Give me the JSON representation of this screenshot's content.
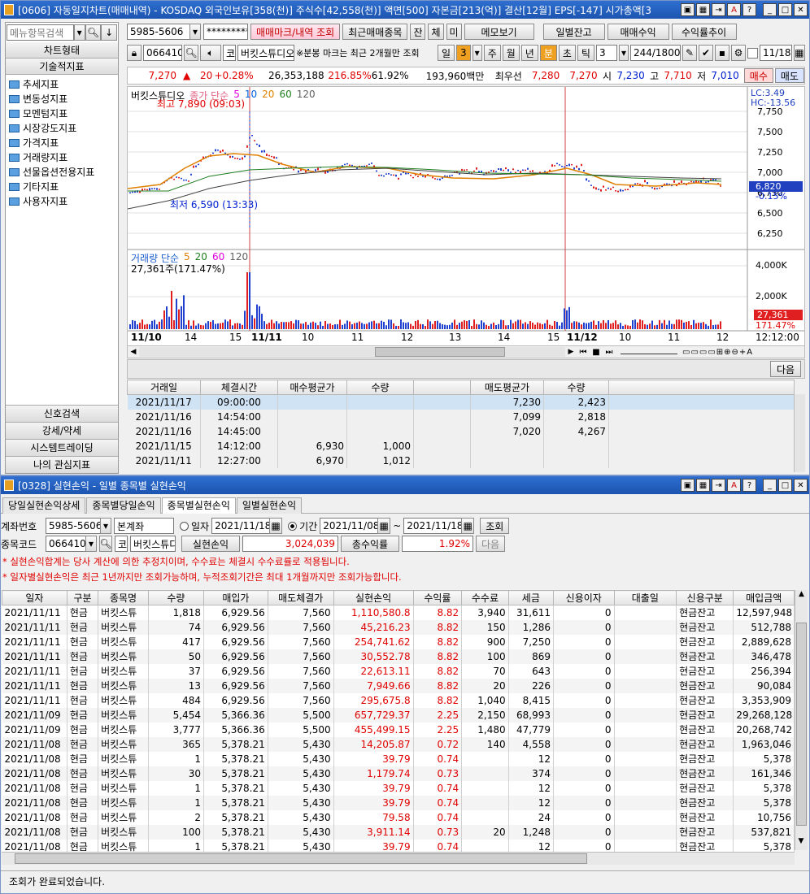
{
  "top_window": {
    "title": "[0606] 자동일지차트(매매내역) - KOSDAQ 외국인보유[358(천)] 주식수[42,558(천)] 액면[500] 자본금[213(억)] 결산[12월] EPS[-147] 시가총액[3"
  },
  "left_panel": {
    "search_placeholder": "메뉴항목검색",
    "tab_chart_type": "차트형태",
    "tab_technical": "기술적지표",
    "tree": [
      "추세지표",
      "변동성지표",
      "모멘텀지표",
      "시장강도지표",
      "가격지표",
      "거래량지표",
      "선물옵션전용지표",
      "기타지표",
      "사용자지표"
    ],
    "bottom": [
      "신호검색",
      "강세/약세",
      "시스템트레이딩",
      "나의 관심지표"
    ]
  },
  "toolbar1": {
    "account": "5985-5606",
    "password": "*********",
    "btn_trade_mark": "매매마크/내역 조회",
    "btn_recent": "최근매매종목",
    "btn_jan": "잔",
    "btn_che": "체",
    "btn_mi": "미",
    "btn_memo": "메모보기",
    "btn_daily_bal": "일별잔고",
    "btn_profit": "매매수익",
    "btn_rate_trend": "수익률추이"
  },
  "toolbar2": {
    "code": "066410",
    "market": "코",
    "stock_name": "버킷스튜디오",
    "note": "※분봉 마크는 최근 2개월만 조회",
    "periods": [
      "일",
      "3",
      "주",
      "월",
      "년",
      "분",
      "초",
      "틱"
    ],
    "interval": "3",
    "count": "244",
    "count_max": "/1800",
    "date": "11/18"
  },
  "quote": {
    "price": "7,270",
    "arrow": "▲",
    "change": "20",
    "change_pct": "+0.28%",
    "volume": "26,353,188",
    "turnover_pct": "216.85%",
    "foreign_pct": "61.92%",
    "amount": "193,960백만",
    "best_ask_label": "최우선",
    "bid": "7,280",
    "ask": "7,270",
    "open_label": "시",
    "open": "7,230",
    "high_label": "고",
    "high": "7,710",
    "low_label": "저",
    "low": "7,010",
    "sell_btn": "매수",
    "buy_btn": "매도"
  },
  "price_chart": {
    "legend_name": "버킷스튜디오",
    "legend_ma": "종가 단순",
    "mas": [
      "5",
      "10",
      "20",
      "60",
      "120"
    ],
    "max_label": "최고 7,890 (09:03)",
    "min_label": "최저 6,590 (13:33)",
    "lc": "LC:3.49",
    "hc": "HC:-13.56",
    "y_ticks": [
      "7,750",
      "7,500",
      "7,250",
      "7,000",
      "6,750",
      "6,500",
      "6,250"
    ],
    "cur_price": "6,820",
    "cur_pct": "-0.15%"
  },
  "volume_chart": {
    "legend": "거래량 단순",
    "mas": [
      "5",
      "20",
      "60",
      "120"
    ],
    "value_label": "27,361주(171.47%)",
    "y_ticks": [
      "4,000K",
      "2,000K"
    ],
    "cur_val": "27,361",
    "cur_pct": "171.47%"
  },
  "x_axis": {
    "labels": [
      "11/10",
      "14",
      "15",
      "11/11",
      "10",
      "11",
      "12",
      "13",
      "14",
      "15",
      "11/12",
      "10",
      "11",
      "12"
    ],
    "time": "12:12:00"
  },
  "next_btn": "다음",
  "trade_table": {
    "headers": [
      "거래일",
      "체결시간",
      "매수평균가",
      "수량",
      "",
      "매도평균가",
      "수량"
    ],
    "rows": [
      [
        "2021/11/17",
        "09:00:00",
        "",
        "",
        "",
        "7,230",
        "2,423"
      ],
      [
        "2021/11/16",
        "14:54:00",
        "",
        "",
        "",
        "7,099",
        "2,818"
      ],
      [
        "2021/11/16",
        "14:45:00",
        "",
        "",
        "",
        "7,020",
        "4,267"
      ],
      [
        "2021/11/15",
        "14:12:00",
        "6,930",
        "1,000",
        "",
        "",
        ""
      ],
      [
        "2021/11/11",
        "12:27:00",
        "6,970",
        "1,012",
        "",
        "",
        ""
      ]
    ]
  },
  "bottom_window": {
    "title": "[0328] 실현손익 - 일별 종목별 실현손익",
    "tabs": [
      "당일실현손익상세",
      "종목별당일손익",
      "종목별실현손익",
      "일별실현손익"
    ],
    "acct_label": "계좌번호",
    "account": "5985-5606",
    "acct_type": "본계좌",
    "radio_date": "일자",
    "date": "2021/11/18",
    "radio_period": "기간",
    "from": "2021/11/08",
    "tilde": "~",
    "to": "2021/11/18",
    "btn_query": "조회",
    "code_label": "종목코드",
    "code": "066410",
    "market": "코",
    "stock_name": "버킷스튜디오",
    "realized_label": "실현손익",
    "realized": "3,024,039",
    "rate_label": "총수익률",
    "rate": "1.92%",
    "btn_next": "다음",
    "notice1": "* 실현손익합계는 당사 계산에 의한 추정치이며, 수수료는 체결시 수수료률로 적용됩니다.",
    "notice2": "* 일자별실현손익은 최근 1년까지만 조회가능하며, 누적조회기간은 최대 1개월까지만 조회가능합니다.",
    "status": "조회가 완료되었습니다."
  },
  "pl_table": {
    "headers": [
      "일자",
      "구분",
      "종목명",
      "수량",
      "매입가",
      "매도체결가",
      "실현손익",
      "수익률",
      "수수료",
      "세금",
      "신용이자",
      "대출일",
      "신용구분",
      "매입금액"
    ],
    "rows": [
      [
        "2021/11/11",
        "현금",
        "버킷스튜",
        "1,818",
        "6,929.56",
        "7,560",
        "1,110,580.8",
        "8.82",
        "3,940",
        "31,611",
        "0",
        "",
        "현금잔고",
        "12,597,948"
      ],
      [
        "2021/11/11",
        "현금",
        "버킷스튜",
        "74",
        "6,929.56",
        "7,560",
        "45,216.23",
        "8.82",
        "150",
        "1,286",
        "0",
        "",
        "현금잔고",
        "512,788"
      ],
      [
        "2021/11/11",
        "현금",
        "버킷스튜",
        "417",
        "6,929.56",
        "7,560",
        "254,741.62",
        "8.82",
        "900",
        "7,250",
        "0",
        "",
        "현금잔고",
        "2,889,628"
      ],
      [
        "2021/11/11",
        "현금",
        "버킷스튜",
        "50",
        "6,929.56",
        "7,560",
        "30,552.78",
        "8.82",
        "100",
        "869",
        "0",
        "",
        "현금잔고",
        "346,478"
      ],
      [
        "2021/11/11",
        "현금",
        "버킷스튜",
        "37",
        "6,929.56",
        "7,560",
        "22,613.11",
        "8.82",
        "70",
        "643",
        "0",
        "",
        "현금잔고",
        "256,394"
      ],
      [
        "2021/11/11",
        "현금",
        "버킷스튜",
        "13",
        "6,929.56",
        "7,560",
        "7,949.66",
        "8.82",
        "20",
        "226",
        "0",
        "",
        "현금잔고",
        "90,084"
      ],
      [
        "2021/11/11",
        "현금",
        "버킷스튜",
        "484",
        "6,929.56",
        "7,560",
        "295,675.8",
        "8.82",
        "1,040",
        "8,415",
        "0",
        "",
        "현금잔고",
        "3,353,909"
      ],
      [
        "2021/11/09",
        "현금",
        "버킷스튜",
        "5,454",
        "5,366.36",
        "5,500",
        "657,729.37",
        "2.25",
        "2,150",
        "68,993",
        "0",
        "",
        "현금잔고",
        "29,268,128"
      ],
      [
        "2021/11/09",
        "현금",
        "버킷스튜",
        "3,777",
        "5,366.36",
        "5,500",
        "455,499.15",
        "2.25",
        "1,480",
        "47,779",
        "0",
        "",
        "현금잔고",
        "20,268,742"
      ],
      [
        "2021/11/08",
        "현금",
        "버킷스튜",
        "365",
        "5,378.21",
        "5,430",
        "14,205.87",
        "0.72",
        "140",
        "4,558",
        "0",
        "",
        "현금잔고",
        "1,963,046"
      ],
      [
        "2021/11/08",
        "현금",
        "버킷스튜",
        "1",
        "5,378.21",
        "5,430",
        "39.79",
        "0.74",
        "",
        "12",
        "0",
        "",
        "현금잔고",
        "5,378"
      ],
      [
        "2021/11/08",
        "현금",
        "버킷스튜",
        "30",
        "5,378.21",
        "5,430",
        "1,179.74",
        "0.73",
        "",
        "374",
        "0",
        "",
        "현금잔고",
        "161,346"
      ],
      [
        "2021/11/08",
        "현금",
        "버킷스튜",
        "1",
        "5,378.21",
        "5,430",
        "39.79",
        "0.74",
        "",
        "12",
        "0",
        "",
        "현금잔고",
        "5,378"
      ],
      [
        "2021/11/08",
        "현금",
        "버킷스튜",
        "1",
        "5,378.21",
        "5,430",
        "39.79",
        "0.74",
        "",
        "12",
        "0",
        "",
        "현금잔고",
        "5,378"
      ],
      [
        "2021/11/08",
        "현금",
        "버킷스튜",
        "2",
        "5,378.21",
        "5,430",
        "79.58",
        "0.74",
        "",
        "24",
        "0",
        "",
        "현금잔고",
        "10,756"
      ],
      [
        "2021/11/08",
        "현금",
        "버킷스튜",
        "100",
        "5,378.21",
        "5,430",
        "3,911.14",
        "0.73",
        "20",
        "1,248",
        "0",
        "",
        "현금잔고",
        "537,821"
      ],
      [
        "2021/11/08",
        "현금",
        "버킷스튜",
        "1",
        "5,378.21",
        "5,430",
        "39.79",
        "0.74",
        "",
        "12",
        "0",
        "",
        "현금잔고",
        "5,378"
      ]
    ]
  },
  "colors": {
    "up": "#e00000",
    "down": "#0020d0",
    "title_bar": "#1c54b0"
  }
}
